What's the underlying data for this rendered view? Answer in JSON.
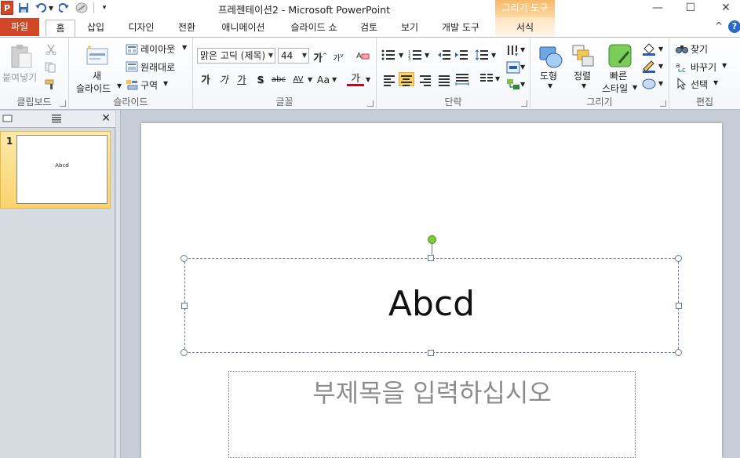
{
  "window": {
    "title": "프레젠테이션2 - Microsoft PowerPoint",
    "contextual_tool": "그리기 도구",
    "minimize": "—",
    "maximize": "☐",
    "close": "✕"
  },
  "tabs": {
    "file": "파일",
    "items": [
      "홈",
      "삽입",
      "디자인",
      "전환",
      "애니메이션",
      "슬라이드 쇼",
      "검토",
      "보기",
      "개발 도구",
      "서식"
    ],
    "active": "홈"
  },
  "ribbon": {
    "clipboard": {
      "label": "클립보드",
      "paste": "붙여넣기"
    },
    "slides": {
      "label": "슬라이드",
      "new_slide_1": "새",
      "new_slide_2": "슬라이드",
      "layout": "레이아웃",
      "reset": "원래대로",
      "section": "구역"
    },
    "font": {
      "label": "글꼴",
      "font_name": "맑은 고딕 (제목)",
      "font_size": "44",
      "bold": "가",
      "italic": "가",
      "underline": "가",
      "shadow": "S",
      "strike": "abc",
      "spacing": "AV",
      "case": "Aa",
      "color": "가",
      "grow": "가",
      "shrink": "가"
    },
    "paragraph": {
      "label": "단락"
    },
    "drawing": {
      "label": "그리기",
      "shapes": "도형",
      "arrange": "정렬",
      "quick_styles_1": "빠른",
      "quick_styles_2": "스타일"
    },
    "editing": {
      "label": "편집",
      "find": "찾기",
      "replace": "바꾸기",
      "select": "선택"
    }
  },
  "slide_pane": {
    "slide_number": "1",
    "thumb_text": "Abcd"
  },
  "slide": {
    "title": "Abcd",
    "subtitle_placeholder": "부제목을 입력하십시오"
  },
  "colors": {
    "file_tab": "#d24726",
    "contextual": "#f7b96a",
    "selection": "#fbd36e",
    "rotate_handle": "#7ccc3c"
  }
}
